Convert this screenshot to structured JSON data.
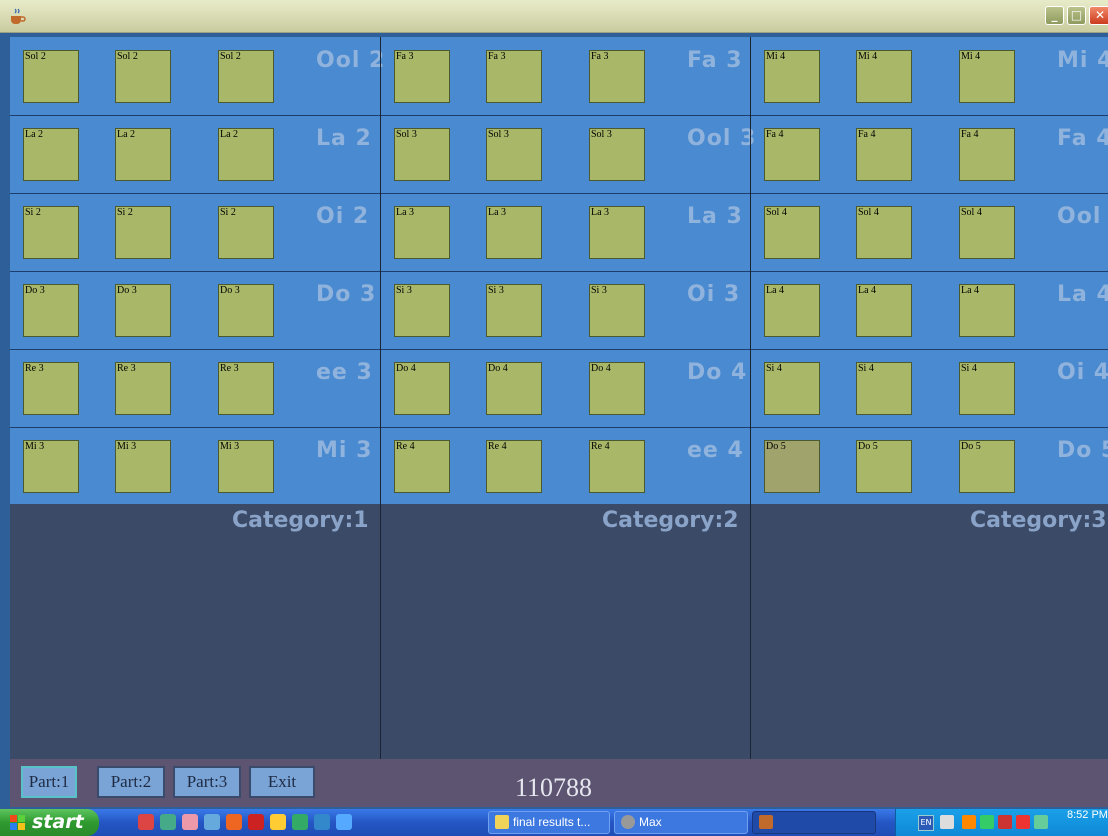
{
  "window": {
    "close_glyph": "✕",
    "minimize_glyph": "_",
    "maximize_glyph": "□"
  },
  "columns": [
    {
      "rows": [
        {
          "note": "Sol 2",
          "ghost": "Ool 2"
        },
        {
          "note": "La 2",
          "ghost": "La 2"
        },
        {
          "note": "Si 2",
          "ghost": "Oi 2"
        },
        {
          "note": "Do 3",
          "ghost": "Do 3"
        },
        {
          "note": "Re 3",
          "ghost": "ee 3"
        },
        {
          "note": "Mi 3",
          "ghost": "Mi 3"
        }
      ]
    },
    {
      "rows": [
        {
          "note": "Fa 3",
          "ghost": "Fa 3"
        },
        {
          "note": "Sol 3",
          "ghost": "Ool 3"
        },
        {
          "note": "La 3",
          "ghost": "La 3"
        },
        {
          "note": "Si 3",
          "ghost": "Oi 3"
        },
        {
          "note": "Do 4",
          "ghost": "Do 4"
        },
        {
          "note": "Re 4",
          "ghost": "ee 4"
        }
      ]
    },
    {
      "rows": [
        {
          "note": "Mi 4",
          "ghost": "Mi 4"
        },
        {
          "note": "Fa 4",
          "ghost": "Fa 4"
        },
        {
          "note": "Sol 4",
          "ghost": "Ool 4"
        },
        {
          "note": "La 4",
          "ghost": "La 4"
        },
        {
          "note": "Si 4",
          "ghost": "Oi 4"
        },
        {
          "note": "Do 5",
          "ghost": "Do 5"
        }
      ]
    }
  ],
  "categories": [
    "Category:1",
    "Category:2",
    "Category:3"
  ],
  "bottom_bar": {
    "buttons": [
      "Part:1",
      "Part:2",
      "Part:3",
      "Exit"
    ],
    "score": "110788"
  },
  "taskbar": {
    "start_label": "start",
    "tasks": [
      {
        "label": "final results t...",
        "icon": "folder-icon"
      },
      {
        "label": "Max",
        "icon": "app-icon"
      },
      {
        "label": "",
        "icon": "java-icon"
      }
    ],
    "language": "EN",
    "time": "8:52 PM"
  },
  "colors": {
    "grid_bg": "#4a8ad0",
    "note_box": "#a8b868",
    "category_bg": "#3b4a66",
    "bottom_bar": "#5c5470"
  }
}
